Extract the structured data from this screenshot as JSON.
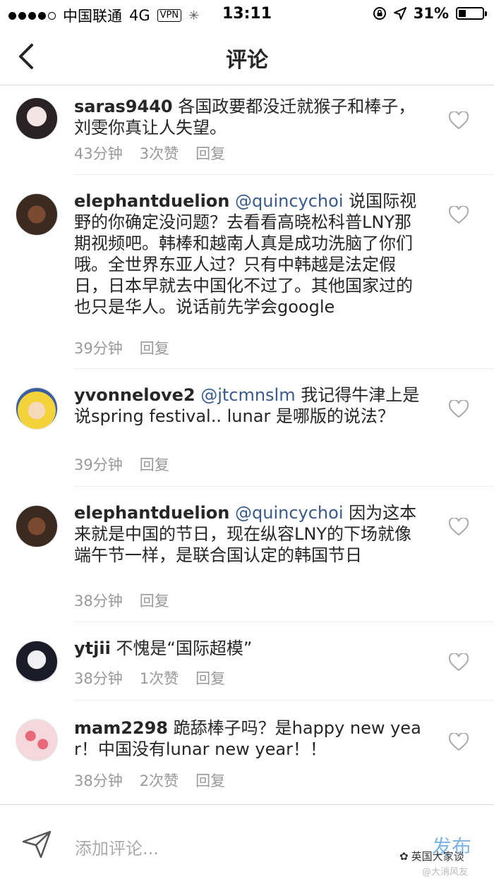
{
  "status": {
    "carrier": "中国联通",
    "network": "4G",
    "vpn": "VPN",
    "time": "13:11",
    "battery": "31%",
    "battery_level": 0.31
  },
  "nav": {
    "title": "评论"
  },
  "comments": [
    {
      "username": "saras9440",
      "mention": "",
      "text": " 各国政要都没迁就猴子和棒子，刘雯你真让人失望。",
      "time": "43分钟",
      "likes": "3次赞",
      "reply": "回复"
    },
    {
      "username": "elephantduelion",
      "mention": " @quincychoi",
      "text": " 说国际视野的你确定没问题？去看看高晓松科普LNY那期视频吧。韩棒和越南人真是成功洗脑了你们哦。全世界东亚人过？只有中韩越是法定假日，日本早就去中国化不过了。其他国家过的也只是华人。说话前先学会google",
      "time": "39分钟",
      "likes": "",
      "reply": "回复"
    },
    {
      "username": "yvonnelove2",
      "mention": " @jtcmnslm",
      "text": " 我记得牛津上是说spring festival.. lunar 是哪版的说法？",
      "time": "39分钟",
      "likes": "",
      "reply": "回复"
    },
    {
      "username": "elephantduelion",
      "mention": " @quincychoi",
      "text": " 因为这本来就是中国的节日，现在纵容LNY的下场就像端午节一样，是联合国认定的韩国节日",
      "time": "38分钟",
      "likes": "",
      "reply": "回复"
    },
    {
      "username": "ytjii",
      "mention": "",
      "text": " 不愧是“国际超模”",
      "time": "38分钟",
      "likes": "1次赞",
      "reply": "回复"
    },
    {
      "username": "mam2298",
      "mention": "",
      "text": " 跪舔棒子吗？是happy new year！中国没有lunar new year！！",
      "time": "38分钟",
      "likes": "2次赞",
      "reply": "回复"
    }
  ],
  "input": {
    "placeholder": "添加评论...",
    "post": "发布"
  },
  "watermark": {
    "text": "英国大家谈",
    "sub": "@大消风友"
  },
  "icons": [
    "back-chevron-icon",
    "heart-icon",
    "send-icon",
    "wechat-icon"
  ],
  "colors": {
    "mention": "#3a5a8c",
    "meta": "#999999",
    "post": "#7fb6e6"
  }
}
